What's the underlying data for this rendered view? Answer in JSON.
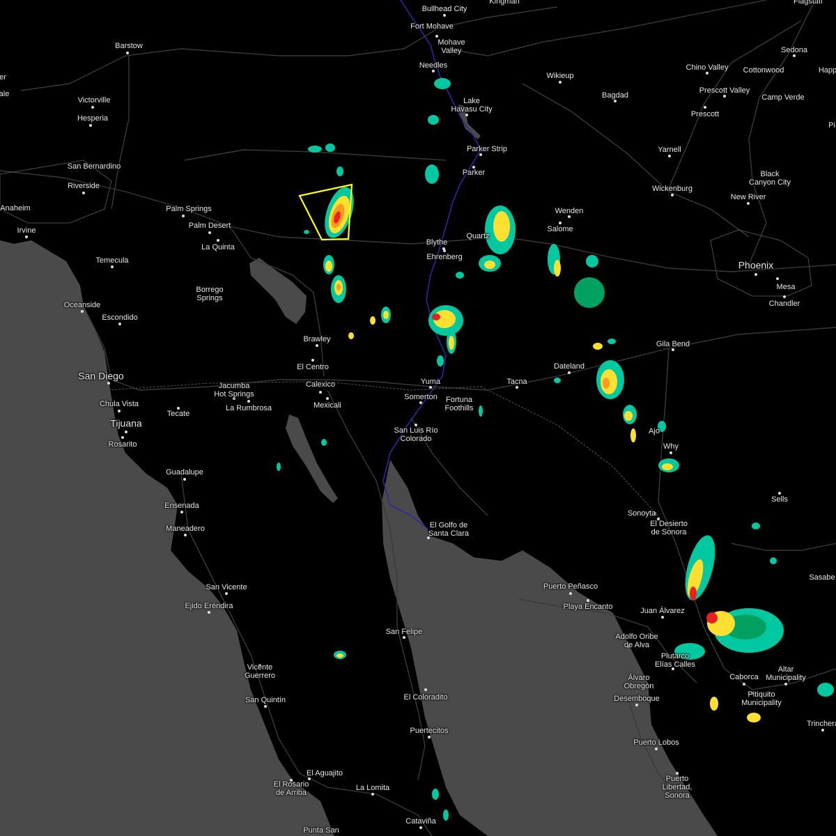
{
  "map": {
    "land_color": "#000000",
    "water_color": "#4a4a4a",
    "road_color": "#3a3a3a",
    "river_color": "#2a2aa0",
    "warning_polygon_color": "#ffff00",
    "radar_palette": [
      "#00c8a0",
      "#00a060",
      "#ffe030",
      "#ff9a20",
      "#e82020"
    ]
  },
  "cities": [
    {
      "id": "bullhead-city",
      "name": "Bullhead City",
      "big": false
    },
    {
      "id": "kingman",
      "name": "Kingman",
      "big": false
    },
    {
      "id": "flagstaff",
      "name": "Flagstaff",
      "big": false
    },
    {
      "id": "fort-mohave",
      "name": "Fort Mohave",
      "big": false
    },
    {
      "id": "mohave-valley",
      "name": "Mohave\nValley",
      "big": false
    },
    {
      "id": "needles",
      "name": "Needles",
      "big": false
    },
    {
      "id": "barstow",
      "name": "Barstow",
      "big": false
    },
    {
      "id": "victorville",
      "name": "Victorville",
      "big": false
    },
    {
      "id": "hesperia",
      "name": "Hesperia",
      "big": false
    },
    {
      "id": "san-bernardino",
      "name": "San Bernardino",
      "big": false
    },
    {
      "id": "riverside",
      "name": "Riverside",
      "big": false
    },
    {
      "id": "anaheim",
      "name": "Anaheim",
      "big": false
    },
    {
      "id": "irvine",
      "name": "Irvine",
      "big": false
    },
    {
      "id": "palm-springs",
      "name": "Palm Springs",
      "big": false
    },
    {
      "id": "palm-desert",
      "name": "Palm Desert",
      "big": false
    },
    {
      "id": "la-quinta",
      "name": "La Quinta",
      "big": false
    },
    {
      "id": "temecula",
      "name": "Temecula",
      "big": false
    },
    {
      "id": "borrego-springs",
      "name": "Borrego\nSprings",
      "big": false
    },
    {
      "id": "oceanside",
      "name": "Oceanside",
      "big": false
    },
    {
      "id": "escondido",
      "name": "Escondido",
      "big": false
    },
    {
      "id": "san-diego",
      "name": "San Diego",
      "big": true
    },
    {
      "id": "chula-vista",
      "name": "Chula Vista",
      "big": false
    },
    {
      "id": "tijuana",
      "name": "Tijuana",
      "big": true
    },
    {
      "id": "rosarito",
      "name": "Rosarito",
      "big": false
    },
    {
      "id": "tecate",
      "name": "Tecate",
      "big": false
    },
    {
      "id": "jacumba",
      "name": "Jacumba\nHot Springs",
      "big": false
    },
    {
      "id": "la-rumbrosa",
      "name": "La Rumbrosa",
      "big": false
    },
    {
      "id": "el-centro",
      "name": "El Centro",
      "big": false
    },
    {
      "id": "calexico",
      "name": "Calexico",
      "big": false
    },
    {
      "id": "mexicali",
      "name": "Mexicali",
      "big": false
    },
    {
      "id": "brawley",
      "name": "Brawley",
      "big": false
    },
    {
      "id": "lake-havasu",
      "name": "Lake\nHavasu City",
      "big": false
    },
    {
      "id": "parker-strip",
      "name": "Parker Strip",
      "big": false
    },
    {
      "id": "parker",
      "name": "Parker",
      "big": false
    },
    {
      "id": "blythe",
      "name": "Blythe",
      "big": false
    },
    {
      "id": "ehrenberg",
      "name": "Ehrenberg",
      "big": false
    },
    {
      "id": "quartzsite",
      "name": "Quartz",
      "big": false
    },
    {
      "id": "wikieup",
      "name": "Wikieup",
      "big": false
    },
    {
      "id": "bagdad",
      "name": "Bagdad",
      "big": false
    },
    {
      "id": "sedona",
      "name": "Sedona",
      "big": false
    },
    {
      "id": "chino-valley",
      "name": "Chino Valley",
      "big": false
    },
    {
      "id": "cottonwood",
      "name": "Cottonwood",
      "big": false
    },
    {
      "id": "prescott-valley",
      "name": "Prescott Valley",
      "big": false
    },
    {
      "id": "camp-verde",
      "name": "Camp Verde",
      "big": false
    },
    {
      "id": "prescott",
      "name": "Prescott",
      "big": false
    },
    {
      "id": "yarnell",
      "name": "Yarnell",
      "big": false
    },
    {
      "id": "black-canyon",
      "name": "Black\nCanyon City",
      "big": false
    },
    {
      "id": "wickenburg",
      "name": "Wickenburg",
      "big": false
    },
    {
      "id": "new-river",
      "name": "New River",
      "big": false
    },
    {
      "id": "wenden",
      "name": "Wenden",
      "big": false
    },
    {
      "id": "salome",
      "name": "Salome",
      "big": false
    },
    {
      "id": "phoenix",
      "name": "Phoenix",
      "big": true
    },
    {
      "id": "mesa",
      "name": "Mesa",
      "big": false
    },
    {
      "id": "chandler",
      "name": "Chandler",
      "big": false
    },
    {
      "id": "gila-bend",
      "name": "Gila Bend",
      "big": false
    },
    {
      "id": "dateland",
      "name": "Dateland",
      "big": false
    },
    {
      "id": "tacna",
      "name": "Tacna",
      "big": false
    },
    {
      "id": "yuma",
      "name": "Yuma",
      "big": false
    },
    {
      "id": "somerton",
      "name": "Somerton",
      "big": false
    },
    {
      "id": "fortuna-foothills",
      "name": "Fortuna\nFoothills",
      "big": false
    },
    {
      "id": "san-luis",
      "name": "San Luis Río\nColorado",
      "big": false
    },
    {
      "id": "ajo",
      "name": "Ajo",
      "big": false
    },
    {
      "id": "why",
      "name": "Why",
      "big": false
    },
    {
      "id": "sells",
      "name": "Sells",
      "big": false
    },
    {
      "id": "sonoyta",
      "name": "Sonoyta",
      "big": false
    },
    {
      "id": "el-desierto",
      "name": "El Desierto\nde Sonora",
      "big": false
    },
    {
      "id": "el-golfo",
      "name": "El Golfo de\nSanta Clara",
      "big": false
    },
    {
      "id": "puerto-penasco",
      "name": "Puerto Peñasco",
      "big": false
    },
    {
      "id": "playa-encanto",
      "name": "Playa Encanto",
      "big": false
    },
    {
      "id": "juan-alvarez",
      "name": "Juan Álvarez",
      "big": false
    },
    {
      "id": "adolfo-oribe",
      "name": "Adolfo Oribe\nde Alva",
      "big": false
    },
    {
      "id": "plutarco",
      "name": "Plutarco\nElías Calles",
      "big": false
    },
    {
      "id": "alvaro-obregon",
      "name": "Álvaro\nObregón",
      "big": false
    },
    {
      "id": "caborca",
      "name": "Caborca",
      "big": false
    },
    {
      "id": "altar",
      "name": "Altar\nMunicipality",
      "big": false
    },
    {
      "id": "pitiquito",
      "name": "Pitiquito\nMunicipality",
      "big": false
    },
    {
      "id": "desemboque",
      "name": "Desemboque",
      "big": false
    },
    {
      "id": "trincheras",
      "name": "Trinchera",
      "big": false
    },
    {
      "id": "sasabe",
      "name": "Sasabe",
      "big": false
    },
    {
      "id": "puerto-lobos",
      "name": "Puerto Lobos",
      "big": false
    },
    {
      "id": "puerto-libertad",
      "name": "Puerto\nLibertad,\nSonora",
      "big": false
    },
    {
      "id": "guadalupe",
      "name": "Guadalupe",
      "big": false
    },
    {
      "id": "ensenada",
      "name": "Ensenada",
      "big": false
    },
    {
      "id": "maneadero",
      "name": "Maneadero",
      "big": false
    },
    {
      "id": "san-vicente",
      "name": "San Vicente",
      "big": false
    },
    {
      "id": "ejido-erendira",
      "name": "Ejido Eréndira",
      "big": false
    },
    {
      "id": "vicente-guerrero",
      "name": "Vicente\nGuerrero",
      "big": false
    },
    {
      "id": "san-quintin",
      "name": "San Quintín",
      "big": false
    },
    {
      "id": "san-felipe",
      "name": "San Felipe",
      "big": false
    },
    {
      "id": "el-coloradito",
      "name": "El Coloradito",
      "big": false
    },
    {
      "id": "puertecitos",
      "name": "Puertecitos",
      "big": false
    },
    {
      "id": "el-aguajito",
      "name": "El Aguajito",
      "big": false
    },
    {
      "id": "el-rosario",
      "name": "El Rosario\nde Arriba",
      "big": false
    },
    {
      "id": "la-lomita",
      "name": "La Lomita",
      "big": false
    },
    {
      "id": "catavina",
      "name": "Cataviña",
      "big": false
    },
    {
      "id": "punta-san",
      "name": "Punta San",
      "big": false
    },
    {
      "id": "happy-jack",
      "name": "Happ",
      "big": false
    },
    {
      "id": "pine",
      "name": "Pi",
      "big": false
    },
    {
      "id": "edge-er",
      "name": "er",
      "big": false
    },
    {
      "id": "edge-ale",
      "name": "ale",
      "big": false
    }
  ]
}
